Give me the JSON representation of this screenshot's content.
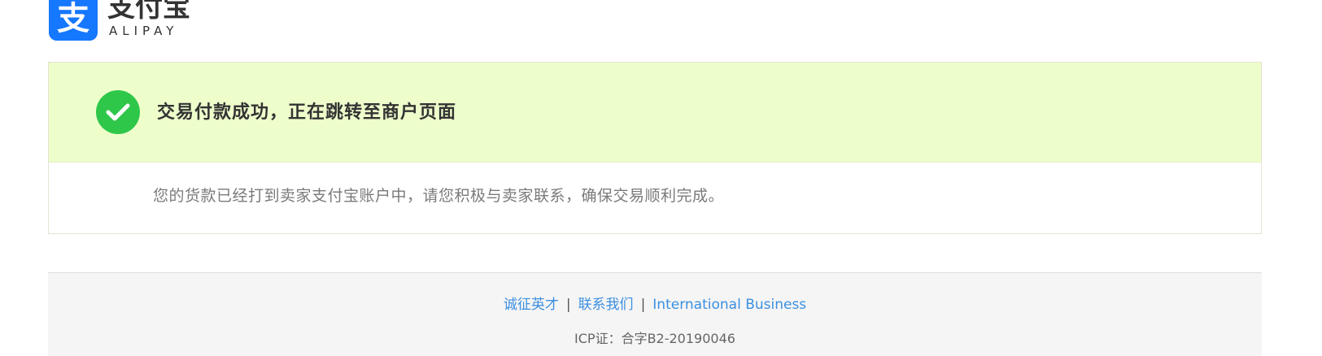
{
  "logo": {
    "mark_char": "支",
    "name_cn": "支付宝",
    "name_en": "ALIPAY",
    "icon": "alipay-logo-icon",
    "brand_color": "#1677ff"
  },
  "result": {
    "icon": "success-check-icon",
    "icon_color": "#2fc74a",
    "title": "交易付款成功，正在跳转至商户页面",
    "message": "您的货款已经打到卖家支付宝账户中，请您积极与卖家联系，确保交易顺利完成。",
    "header_bg": "#eefecb"
  },
  "footer": {
    "links": [
      "诚征英才",
      "联系我们",
      "International Business"
    ],
    "separator": "|",
    "icp": "ICP证：合字B2-20190046",
    "link_color": "#3b8fe0"
  }
}
